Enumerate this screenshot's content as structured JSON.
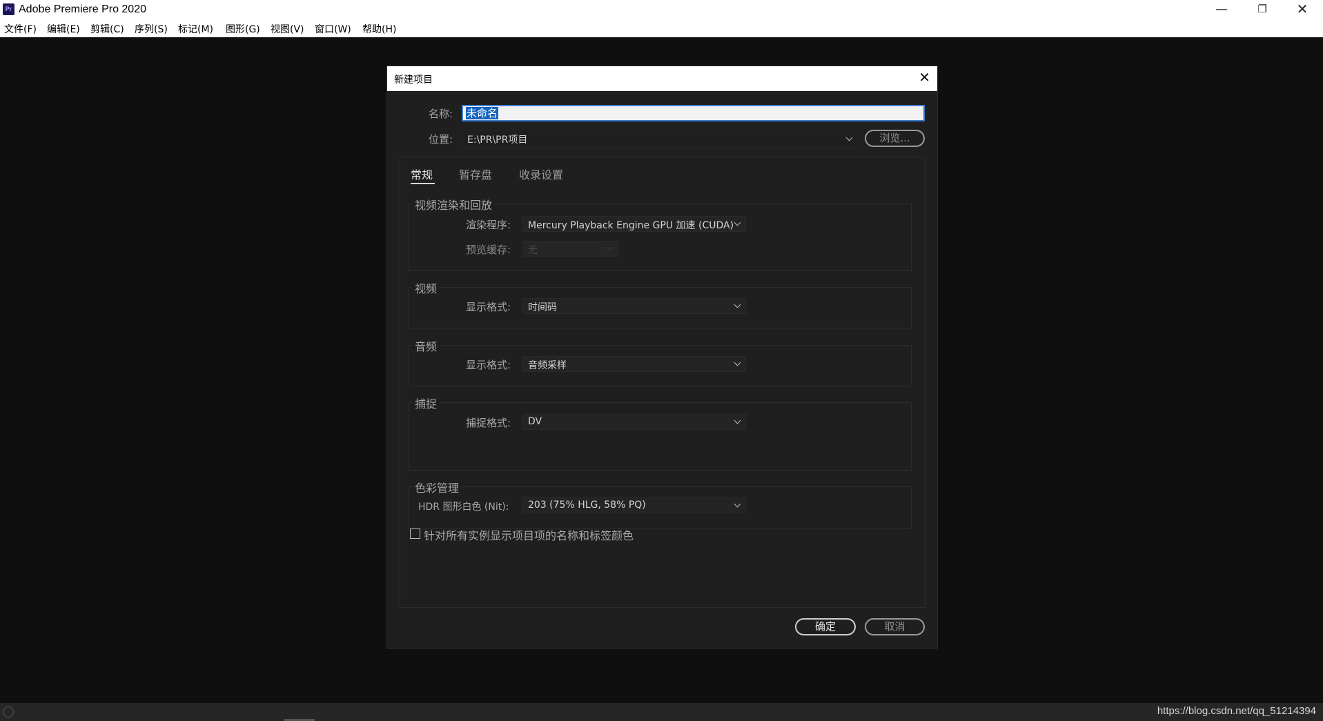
{
  "window": {
    "title": "Adobe Premiere Pro 2020",
    "icon": "Pr"
  },
  "menu": [
    {
      "label": "文件(F)"
    },
    {
      "label": "编辑(E)"
    },
    {
      "label": "剪辑(C)"
    },
    {
      "label": "序列(S)"
    },
    {
      "label": "标记(M)"
    },
    {
      "label": "图形(G)"
    },
    {
      "label": "视图(V)"
    },
    {
      "label": "窗口(W)"
    },
    {
      "label": "帮助(H)"
    }
  ],
  "dialog": {
    "title": "新建项目",
    "name_label": "名称:",
    "name_value": "未命名",
    "location_label": "位置:",
    "location_value": "E:\\PR\\PR项目",
    "browse_label": "浏览...",
    "tabs": [
      {
        "label": "常规",
        "active": true
      },
      {
        "label": "暂存盘"
      },
      {
        "label": "收录设置"
      }
    ],
    "render_group": {
      "title": "视频渲染和回放",
      "renderer_label": "渲染程序:",
      "renderer_value": "Mercury Playback Engine GPU 加速 (CUDA)",
      "preview_cache_label": "预览缓存:",
      "preview_cache_value": "无"
    },
    "video_group": {
      "title": "视频",
      "display_format_label": "显示格式:",
      "display_format_value": "时间码"
    },
    "audio_group": {
      "title": "音频",
      "display_format_label": "显示格式:",
      "display_format_value": "音频采样"
    },
    "capture_group": {
      "title": "捕捉",
      "capture_format_label": "捕捉格式:",
      "capture_format_value": "DV"
    },
    "color_group": {
      "title": "色彩管理",
      "hdr_label": "HDR 图形白色 (Nit):",
      "hdr_value": "203 (75% HLG, 58% PQ)"
    },
    "checkbox_label": "针对所有实例显示项目项的名称和标签颜色",
    "checkbox_checked": false,
    "ok_label": "确定",
    "cancel_label": "取消"
  },
  "statusbar": {
    "watermark": "https://blog.csdn.net/qq_51214394"
  },
  "colors": {
    "accent": "#1565c0",
    "background": "#0f0f0f",
    "dialog_bg": "#1f1f1f"
  }
}
